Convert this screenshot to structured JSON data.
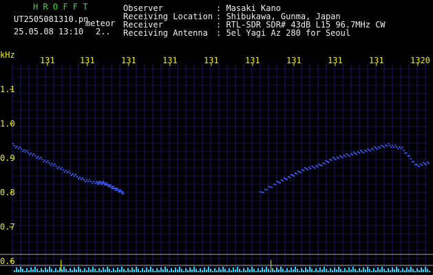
{
  "header": {
    "brand": "H R O F F T",
    "filename": "UT2505081310.pn",
    "tag": "meteor",
    "datetime": "25.05.08 13:10",
    "page_marker": "2..",
    "info_labels": [
      "Observer",
      "Receiving Location",
      "Receiver",
      "Receiving Antenna"
    ],
    "info_values": [
      ": Masaki Kano",
      ": Shibukawa, Gunma, Japan",
      ": RTL-SDR SDR# 43dB L15 96.7MHz CW",
      ": 5el Yagi Az 280 for Seoul"
    ]
  },
  "colors": {
    "brand_green": "#2fe12f",
    "axis_yellow": "#f0f000",
    "grid_navy": "#1a1a70",
    "trace_blue": "#3a5cff",
    "signal_cyan": "#20d8ff"
  },
  "chart_data": {
    "type": "heatmap",
    "ylabel": "kHz",
    "x_ticks": [
      "131",
      "131",
      "131",
      "131",
      "131",
      "131",
      "131",
      "131",
      "131",
      "1320"
    ],
    "y_ticks": [
      "1.1",
      "1.0",
      "0.9",
      "0.8",
      "0.7",
      "0.6"
    ],
    "ylim": [
      0.6,
      1.1
    ],
    "grid": true,
    "traces": [
      {
        "x": [
          0,
          2,
          4,
          6,
          8,
          10,
          12,
          13,
          14,
          15,
          16
        ],
        "y": [
          0.94,
          0.92,
          0.9,
          0.88,
          0.86,
          0.84,
          0.83,
          0.83,
          0.82,
          0.81,
          0.8
        ]
      },
      {
        "x": [
          35.5,
          38,
          40,
          42,
          44,
          46,
          48,
          50,
          52,
          54,
          56,
          58,
          60
        ],
        "y": [
          0.8,
          0.83,
          0.85,
          0.87,
          0.88,
          0.9,
          0.91,
          0.92,
          0.93,
          0.94,
          0.93,
          0.88,
          0.89
        ]
      }
    ],
    "spikes_x": [
      7,
      37.2
    ]
  }
}
